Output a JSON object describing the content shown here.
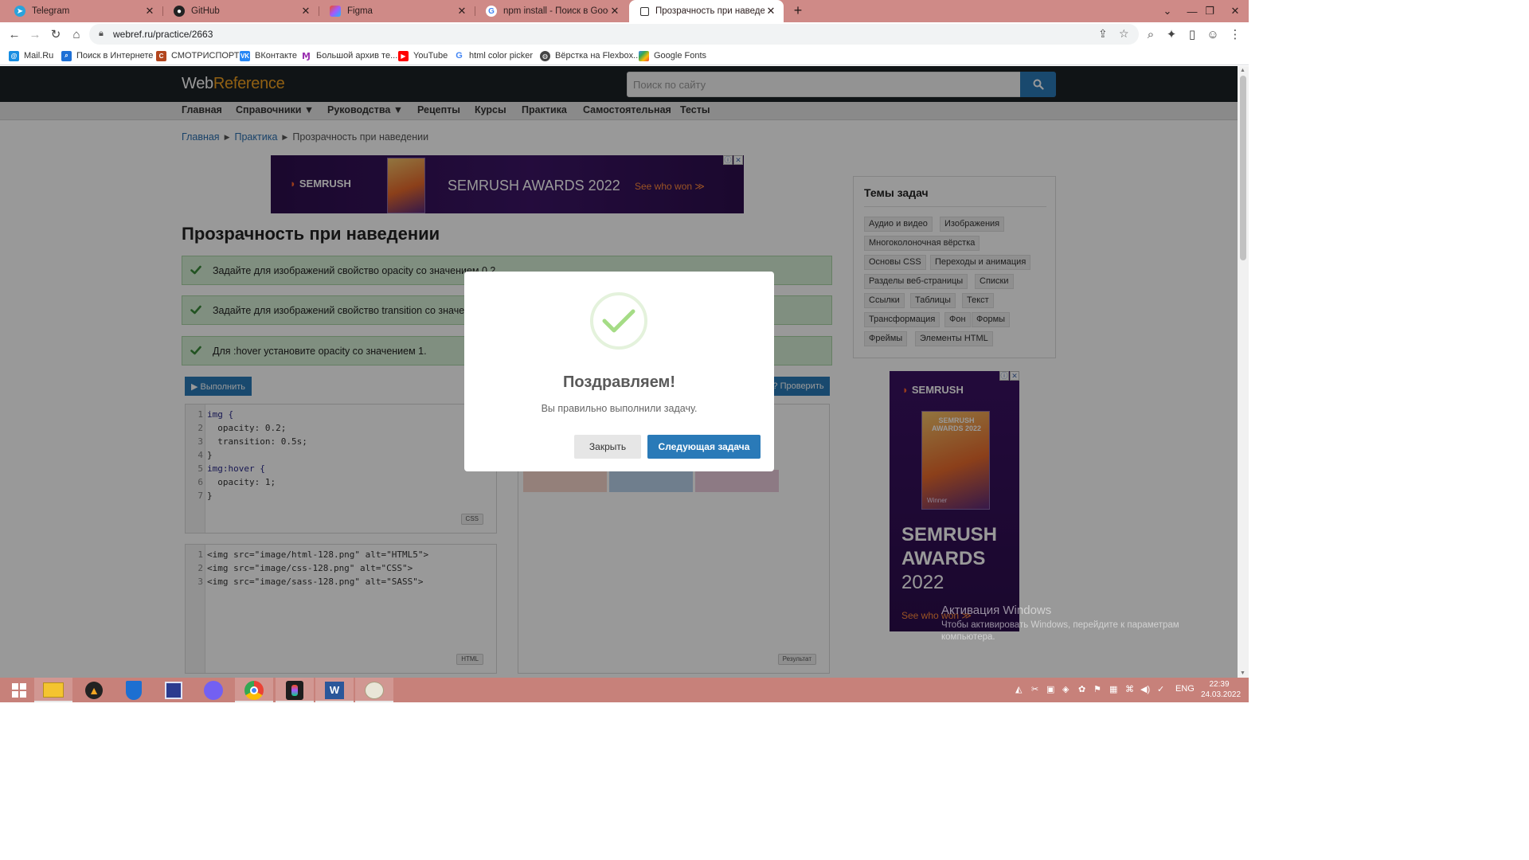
{
  "browser": {
    "tabs": [
      {
        "title": "Telegram",
        "icon": "telegram-icon"
      },
      {
        "title": "GitHub",
        "icon": "github-icon"
      },
      {
        "title": "Figma",
        "icon": "figma-icon"
      },
      {
        "title": "npm install - Поиск в Google",
        "icon": "google-icon"
      },
      {
        "title": "Прозрачность при наведении |",
        "icon": "webref-icon",
        "active": true
      }
    ],
    "url": "webref.ru/practice/2663",
    "bookmarks": [
      {
        "label": "Mail.Ru",
        "icon": "mailru-icon"
      },
      {
        "label": "Поиск в Интернете",
        "icon": "search-icon"
      },
      {
        "label": "СМОТРИСПОРТ",
        "icon": "smotrisport-icon"
      },
      {
        "label": "ВКонтакте",
        "icon": "vk-icon"
      },
      {
        "label": "Большой архив те...",
        "icon": "archive-icon"
      },
      {
        "label": "YouTube",
        "icon": "youtube-icon"
      },
      {
        "label": "html color picker",
        "icon": "google-icon"
      },
      {
        "label": "Вёрстка на Flexbox...",
        "icon": "globe-icon"
      },
      {
        "label": "Google Fonts",
        "icon": "google-fonts-icon"
      }
    ]
  },
  "site": {
    "logo": {
      "web": "Web",
      "ref": "Reference"
    },
    "search_placeholder": "Поиск по сайту",
    "nav": [
      "Главная",
      "Справочники ▼",
      "Руководства ▼",
      "Рецепты",
      "Курсы",
      "Практика",
      "Самостоятельная",
      "Тесты"
    ],
    "breadcrumb": [
      "Главная",
      "Практика",
      "Прозрачность при наведении"
    ]
  },
  "ad_top": {
    "brand": "SEMRUSH",
    "headline": "SEMRUSH AWARDS 2022",
    "cta": "See who won ≫"
  },
  "ad_side": {
    "brand": "SEMRUSH",
    "trophy_text": "SEMRUSH AWARDS 2022",
    "winner": "Winner",
    "headline_1": "SEMRUSH",
    "headline_2": "AWARDS",
    "headline_3": "2022",
    "cta": "See who won ≫"
  },
  "practice": {
    "title": "Прозрачность при наведении",
    "tasks": [
      "Задайте для изображений свойство opacity со значением 0.2.",
      "Задайте для изображений свойство transition со значением 0.5s.",
      "Для :hover установите opacity со значением 1."
    ],
    "run_label": "▶ Выполнить",
    "check_label": "? Проверить",
    "css_tag": "CSS",
    "html_tag": "HTML",
    "result_tag": "Результат",
    "css_code": [
      "img {",
      "  opacity: 0.2;",
      "  transition: 0.5s;",
      "}",
      "img:hover {",
      "  opacity: 1;",
      "}"
    ],
    "html_code": [
      "<img src=\"image/html-128.png\" alt=\"HTML5\">",
      "<img src=\"image/css-128.png\" alt=\"CSS\">",
      "<img src=\"image/sass-128.png\" alt=\"SASS\">"
    ]
  },
  "sidebar": {
    "title": "Темы задач",
    "topics": [
      "Аудио и видео",
      "Изображения",
      "Многоколоночная вёрстка",
      "Основы CSS",
      "Переходы и анимация",
      "Разделы веб-страницы",
      "Списки",
      "Ссылки",
      "Таблицы",
      "Текст",
      "Трансформация",
      "Фон",
      "Формы",
      "Фреймы",
      "Элементы HTML"
    ]
  },
  "modal": {
    "title": "Поздравляем!",
    "message": "Вы правильно выполнили задачу.",
    "close_label": "Закрыть",
    "next_label": "Следующая задача",
    "success_color": "#a5dc86"
  },
  "watermark": {
    "title": "Активация Windows",
    "text": "Чтобы активировать Windows, перейдите к параметрам компьютера."
  },
  "taskbar": {
    "apps": [
      "windows-start-icon",
      "file-explorer-icon",
      "avast-icon",
      "defender-icon",
      "save-disk-icon",
      "viber-icon",
      "chrome-icon",
      "figma-icon",
      "word-icon",
      "paint-icon"
    ],
    "language": "ENG",
    "time": "22:39",
    "date": "24.03.2022"
  }
}
